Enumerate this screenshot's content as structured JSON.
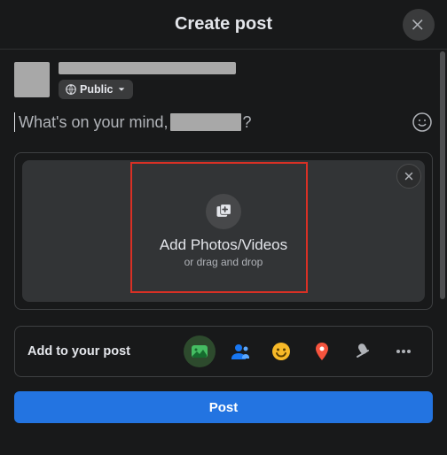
{
  "header": {
    "title": "Create post"
  },
  "audience": {
    "label": "Public"
  },
  "composer": {
    "placeholder_prefix": "What's on your mind, ",
    "placeholder_suffix": "?"
  },
  "upload": {
    "title": "Add Photos/Videos",
    "subtitle": "or drag and drop"
  },
  "add_row": {
    "label": "Add to your post"
  },
  "post_button": {
    "label": "Post"
  },
  "icons": {
    "photo": "photo-video-icon",
    "tag": "tag-people-icon",
    "feeling": "feeling-icon",
    "checkin": "check-in-icon",
    "mic": "microphone-icon",
    "more": "more-icon"
  },
  "colors": {
    "accent": "#2374e1",
    "highlight": "#d93025",
    "photo_green": "#45bd62",
    "tag_blue": "#1877f2",
    "feeling_yellow": "#f7b928",
    "checkin_red": "#f5533d"
  }
}
